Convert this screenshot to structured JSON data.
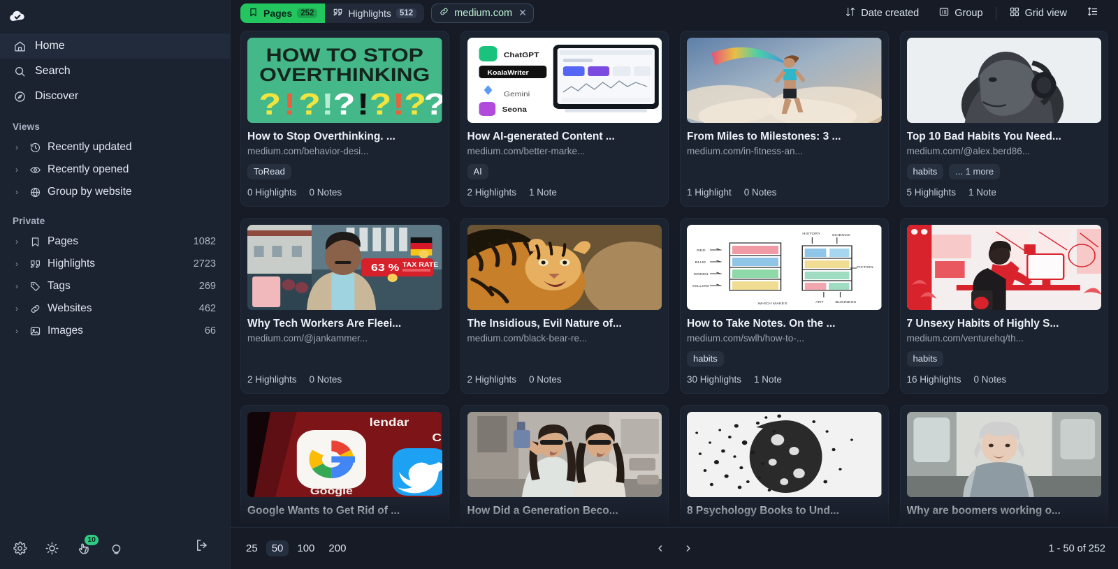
{
  "app": {
    "logo_icon": "cloud-check-icon"
  },
  "sidebar": {
    "nav": [
      {
        "label": "Home",
        "icon": "home-icon",
        "active": true
      },
      {
        "label": "Search",
        "icon": "search-icon",
        "active": false
      },
      {
        "label": "Discover",
        "icon": "compass-icon",
        "active": false
      }
    ],
    "views": {
      "title": "Views",
      "items": [
        {
          "label": "Recently updated",
          "icon": "history-icon"
        },
        {
          "label": "Recently opened",
          "icon": "eye-icon"
        },
        {
          "label": "Group by website",
          "icon": "globe-icon"
        }
      ]
    },
    "private": {
      "title": "Private",
      "items": [
        {
          "label": "Pages",
          "icon": "bookmark-icon",
          "count": "1082"
        },
        {
          "label": "Highlights",
          "icon": "quote-icon",
          "count": "2723"
        },
        {
          "label": "Tags",
          "icon": "tag-icon",
          "count": "269"
        },
        {
          "label": "Websites",
          "icon": "link-icon",
          "count": "462"
        },
        {
          "label": "Images",
          "icon": "image-icon",
          "count": "66"
        }
      ]
    },
    "footer": {
      "icons": [
        {
          "name": "gear-icon"
        },
        {
          "name": "brightness-icon"
        },
        {
          "name": "notifications-icon",
          "badge": "10"
        },
        {
          "name": "lightbulb-icon"
        }
      ],
      "logout_icon": "logout-icon"
    }
  },
  "topbar": {
    "filters": [
      {
        "label": "Pages",
        "icon": "bookmark-icon",
        "count": "252",
        "active": true
      },
      {
        "label": "Highlights",
        "icon": "quote-icon",
        "count": "512",
        "active": false
      }
    ],
    "chip": {
      "label": "medium.com",
      "icon": "link-icon",
      "close_icon": "close-icon"
    },
    "sort": {
      "label": "Date created",
      "icon": "sort-arrows-icon"
    },
    "group": {
      "label": "Group",
      "icon": "group-list-icon"
    },
    "view": {
      "label": "Grid view",
      "icon": "grid-icon"
    },
    "density": {
      "icon": "density-icon"
    }
  },
  "cards": [
    {
      "title": "How to Stop Overthinking. ...",
      "url": "medium.com/behavior-desi...",
      "tags": [
        "ToRead"
      ],
      "highlights": "0 Highlights",
      "notes": "0 Notes",
      "thumb": "overthinking"
    },
    {
      "title": "How AI-generated Content ...",
      "url": "medium.com/better-marke...",
      "tags": [
        "AI"
      ],
      "highlights": "2 Highlights",
      "notes": "1 Note",
      "thumb": "ai-tools"
    },
    {
      "title": "From Miles to Milestones: 3 ...",
      "url": "medium.com/in-fitness-an...",
      "tags": [],
      "highlights": "1 Highlight",
      "notes": "0 Notes",
      "thumb": "runner"
    },
    {
      "title": "Top 10 Bad Habits You Need...",
      "url": "medium.com/@alex.berd86...",
      "tags": [
        "habits",
        "... 1 more"
      ],
      "highlights": "5 Highlights",
      "notes": "1 Note",
      "thumb": "headphones"
    },
    {
      "title": "Why Tech Workers Are Fleei...",
      "url": "medium.com/@jankammer...",
      "tags": [],
      "highlights": "2 Highlights",
      "notes": "0 Notes",
      "thumb": "taxrate"
    },
    {
      "title": "The Insidious, Evil Nature of...",
      "url": "medium.com/black-bear-re...",
      "tags": [],
      "highlights": "2 Highlights",
      "notes": "0 Notes",
      "thumb": "tiger"
    },
    {
      "title": "How to Take Notes. On the ...",
      "url": "medium.com/swlh/how-to-...",
      "tags": [
        "habits"
      ],
      "highlights": "30 Highlights",
      "notes": "1 Note",
      "thumb": "bookshelf"
    },
    {
      "title": "7 Unsexy Habits of Highly S...",
      "url": "medium.com/venturehq/th...",
      "tags": [
        "habits"
      ],
      "highlights": "16 Highlights",
      "notes": "0 Notes",
      "thumb": "deskwork"
    },
    {
      "title": "Google Wants to Get Rid of ...",
      "url": "",
      "tags": [],
      "highlights": "",
      "notes": "",
      "thumb": "google"
    },
    {
      "title": "How Did a Generation Beco...",
      "url": "",
      "tags": [],
      "highlights": "",
      "notes": "",
      "thumb": "selfie"
    },
    {
      "title": "8 Psychology Books to Und...",
      "url": "",
      "tags": [],
      "highlights": "",
      "notes": "",
      "thumb": "dispersion"
    },
    {
      "title": "Why are boomers working o...",
      "url": "",
      "tags": [],
      "highlights": "",
      "notes": "",
      "thumb": "elderly"
    }
  ],
  "bottombar": {
    "page_sizes": [
      {
        "label": "25",
        "active": false
      },
      {
        "label": "50",
        "active": true
      },
      {
        "label": "100",
        "active": false
      },
      {
        "label": "200",
        "active": false
      }
    ],
    "prev_icon": "chevron-left-icon",
    "next_icon": "chevron-right-icon",
    "range": "1 - 50 of 252"
  },
  "colors": {
    "accent": "#22c55e",
    "bg": "#161b26",
    "sidebar": "#1b2230",
    "card": "#1c2330"
  }
}
